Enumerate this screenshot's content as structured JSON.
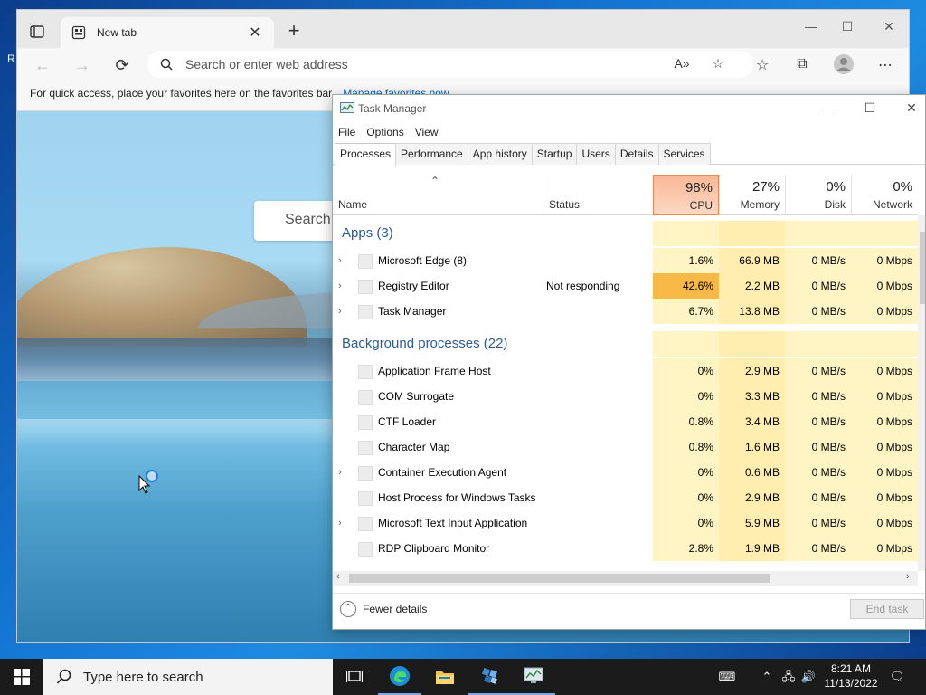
{
  "desktop": {
    "edge_letter": "R"
  },
  "edge": {
    "tab_title": "New tab",
    "address_placeholder": "Search or enter web address",
    "favbar_text": "For quick access, place your favorites here on the favorites bar.",
    "favbar_link": "Manage favorites now",
    "page_search_label": "Search"
  },
  "taskmanager": {
    "title": "Task Manager",
    "menu": [
      "File",
      "Options",
      "View"
    ],
    "tabs": [
      "Processes",
      "Performance",
      "App history",
      "Startup",
      "Users",
      "Details",
      "Services"
    ],
    "active_tab": "Processes",
    "headers": {
      "name": "Name",
      "status": "Status",
      "cpu_pct": "98%",
      "cpu": "CPU",
      "mem_pct": "27%",
      "mem": "Memory",
      "disk_pct": "0%",
      "disk": "Disk",
      "net_pct": "0%",
      "net": "Network"
    },
    "groups": [
      {
        "title": "Apps (3)",
        "rows": [
          {
            "name": "Microsoft Edge (8)",
            "status": "",
            "cpu": "1.6%",
            "mem": "66.9 MB",
            "disk": "0 MB/s",
            "net": "0 Mbps",
            "expandable": true
          },
          {
            "name": "Registry Editor",
            "status": "Not responding",
            "cpu": "42.6%",
            "mem": "2.2 MB",
            "disk": "0 MB/s",
            "net": "0 Mbps",
            "expandable": true
          },
          {
            "name": "Task Manager",
            "status": "",
            "cpu": "6.7%",
            "mem": "13.8 MB",
            "disk": "0 MB/s",
            "net": "0 Mbps",
            "expandable": true
          }
        ]
      },
      {
        "title": "Background processes (22)",
        "rows": [
          {
            "name": "Application Frame Host",
            "status": "",
            "cpu": "0%",
            "mem": "2.9 MB",
            "disk": "0 MB/s",
            "net": "0 Mbps",
            "expandable": false
          },
          {
            "name": "COM Surrogate",
            "status": "",
            "cpu": "0%",
            "mem": "3.3 MB",
            "disk": "0 MB/s",
            "net": "0 Mbps",
            "expandable": false
          },
          {
            "name": "CTF Loader",
            "status": "",
            "cpu": "0.8%",
            "mem": "3.4 MB",
            "disk": "0 MB/s",
            "net": "0 Mbps",
            "expandable": false
          },
          {
            "name": "Character Map",
            "status": "",
            "cpu": "0.8%",
            "mem": "1.6 MB",
            "disk": "0 MB/s",
            "net": "0 Mbps",
            "expandable": false
          },
          {
            "name": "Container Execution Agent",
            "status": "",
            "cpu": "0%",
            "mem": "0.6 MB",
            "disk": "0 MB/s",
            "net": "0 Mbps",
            "expandable": true
          },
          {
            "name": "Host Process for Windows Tasks",
            "status": "",
            "cpu": "0%",
            "mem": "2.9 MB",
            "disk": "0 MB/s",
            "net": "0 Mbps",
            "expandable": false
          },
          {
            "name": "Microsoft Text Input Application",
            "status": "",
            "cpu": "0%",
            "mem": "5.9 MB",
            "disk": "0 MB/s",
            "net": "0 Mbps",
            "expandable": true
          },
          {
            "name": "RDP Clipboard Monitor",
            "status": "",
            "cpu": "2.8%",
            "mem": "1.9 MB",
            "disk": "0 MB/s",
            "net": "0 Mbps",
            "expandable": false
          }
        ]
      }
    ],
    "fewer_details": "Fewer details",
    "end_task": "End task"
  },
  "taskbar": {
    "search_placeholder": "Type here to search",
    "time": "8:21 AM",
    "date": "11/13/2022"
  },
  "colors": {
    "accent": "#0a62c4",
    "group_title": "#2d5c9c",
    "cpu_header": "#f9b896",
    "heat_hot": "#f9b947",
    "heat": "#fff4c4"
  }
}
